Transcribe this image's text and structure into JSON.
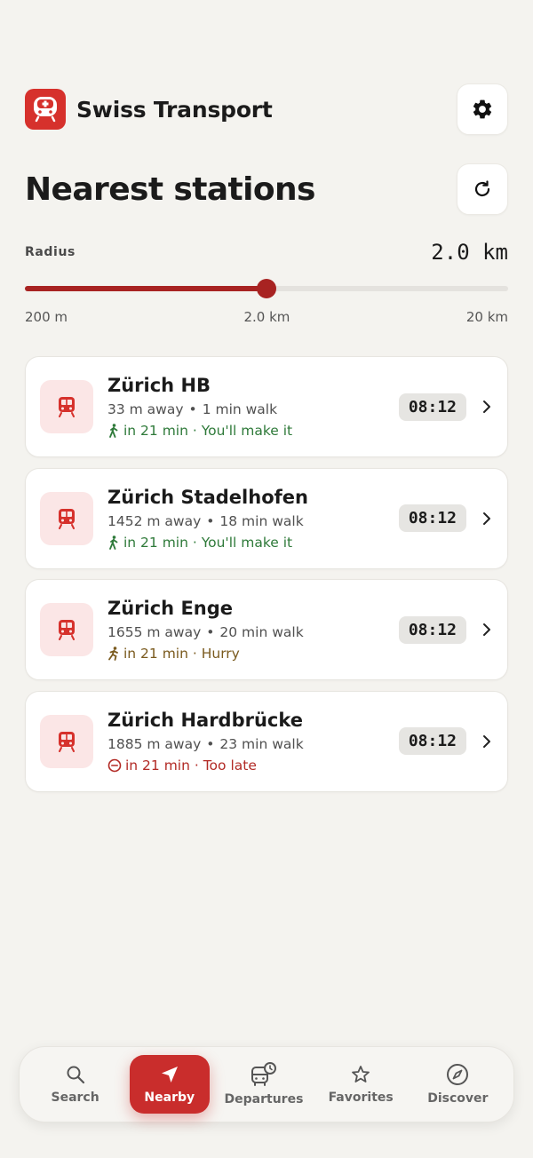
{
  "app": {
    "title": "Swiss Transport"
  },
  "page": {
    "title": "Nearest stations"
  },
  "radius": {
    "label": "Radius",
    "value": "2.0 km",
    "fraction": 0.5,
    "ticks": [
      "200 m",
      "2.0 km",
      "20 km"
    ]
  },
  "stations": [
    {
      "name": "Zürich HB",
      "distance": "33 m away",
      "walk": "1 min walk",
      "status": "in 21 min · You'll make it",
      "status_type": "ok",
      "time": "08:12"
    },
    {
      "name": "Zürich Stadelhofen",
      "distance": "1452 m away",
      "walk": "18 min walk",
      "status": "in 21 min · You'll make it",
      "status_type": "ok",
      "time": "08:12"
    },
    {
      "name": "Zürich Enge",
      "distance": "1655 m away",
      "walk": "20 min walk",
      "status": "in 21 min · Hurry",
      "status_type": "hurry",
      "time": "08:12"
    },
    {
      "name": "Zürich Hardbrücke",
      "distance": "1885 m away",
      "walk": "23 min walk",
      "status": "in 21 min · Too late",
      "status_type": "late",
      "time": "08:12"
    }
  ],
  "nav": {
    "search": "Search",
    "nearby": "Nearby",
    "departures": "Departures",
    "favorites": "Favorites",
    "discover": "Discover"
  },
  "colors": {
    "brand": "#d6312c",
    "accent": "#a82322",
    "ok": "#2f7a3a",
    "hurry": "#7a5a1e",
    "late": "#b22a25"
  }
}
